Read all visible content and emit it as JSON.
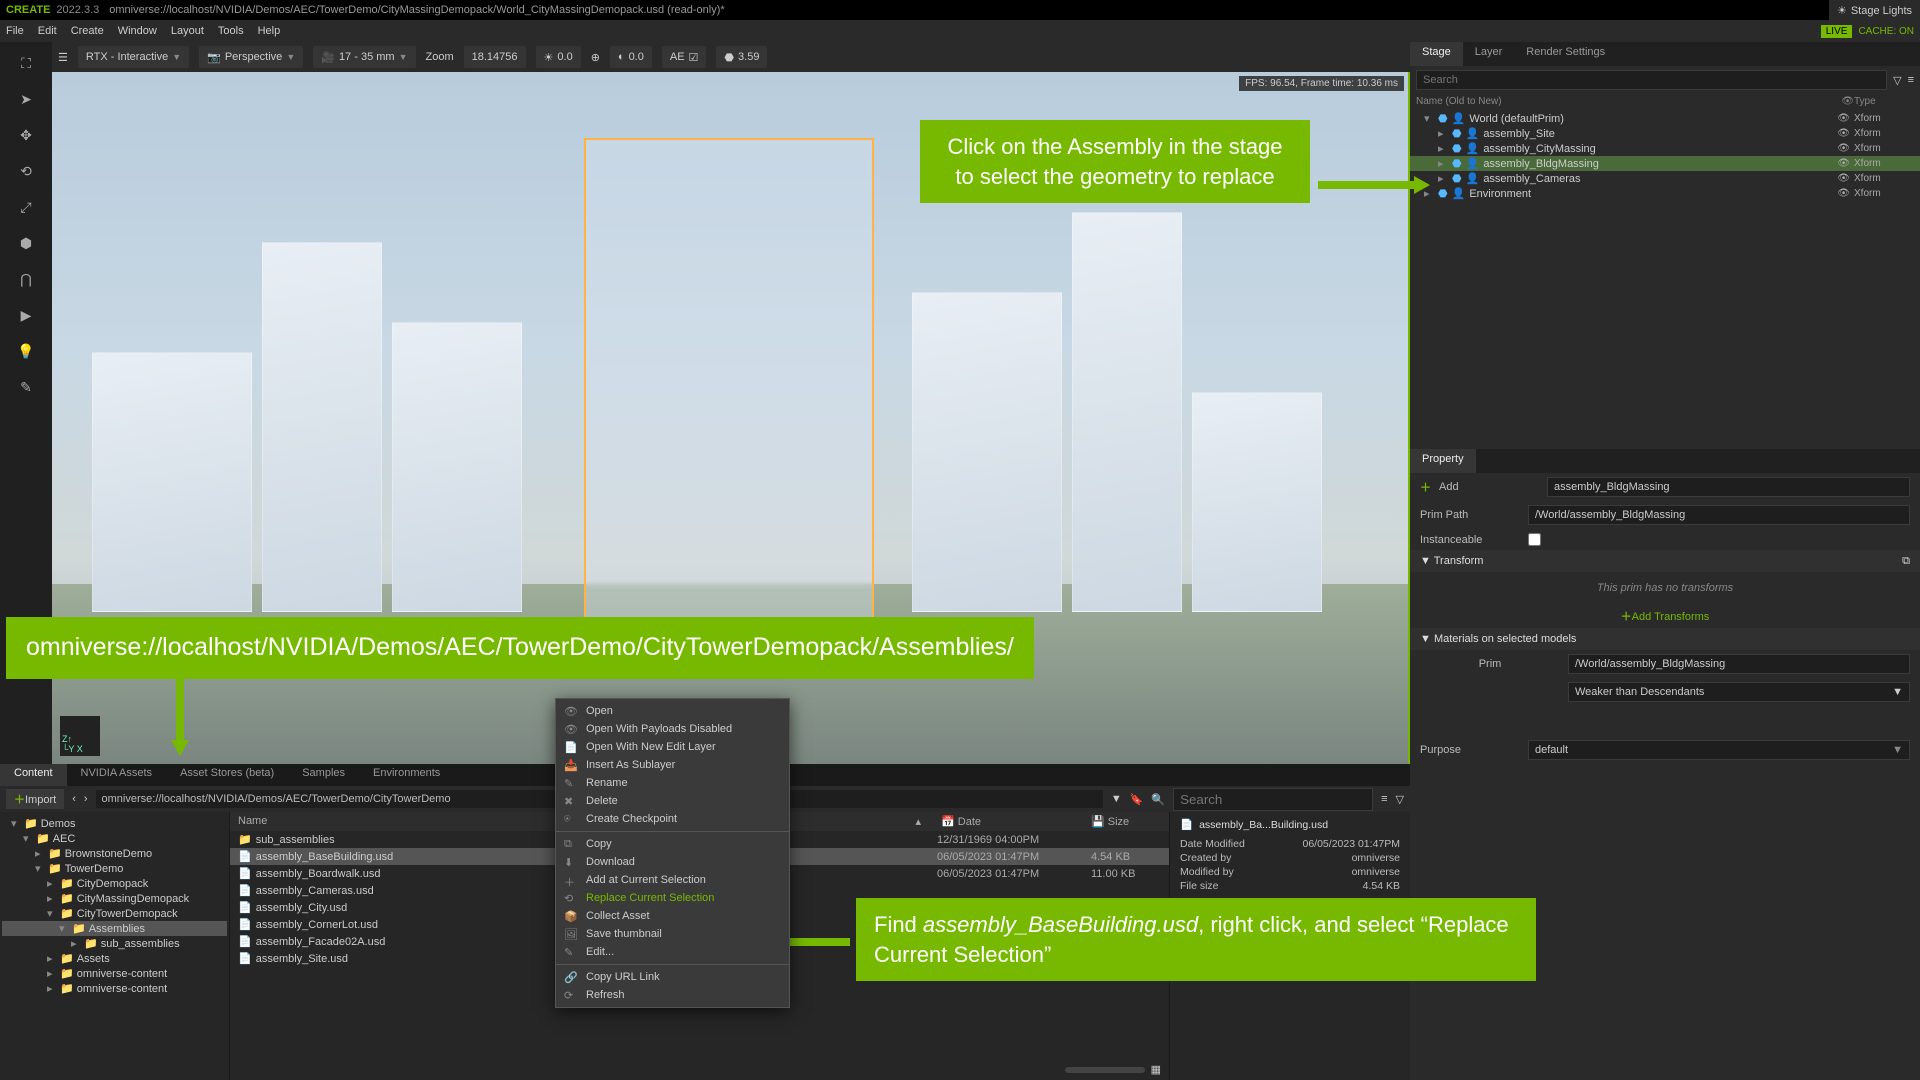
{
  "title": {
    "app": "CREATE",
    "ver": "2022.3.3",
    "path": "omniverse://localhost/NVIDIA/Demos/AEC/TowerDemo/CityMassingDemopack/World_CityMassingDemopack.usd (read-only)*"
  },
  "menubar": [
    "File",
    "Edit",
    "Create",
    "Window",
    "Layout",
    "Tools",
    "Help"
  ],
  "live": "LIVE",
  "cache": "CACHE: ON",
  "toolbar": {
    "rtx": "RTX - Interactive",
    "persp": "Perspective",
    "lens": "17 - 35 mm",
    "zoom_lbl": "Zoom",
    "zoom": "18.14756",
    "exp1": "0.0",
    "exp2": "0.0",
    "ae": "AE",
    "fstop": "3.59",
    "stagelights": "Stage Lights"
  },
  "vp": {
    "fps": "FPS: 96.54, Frame time: 10.36 ms"
  },
  "rightTabs": [
    "Stage",
    "Layer",
    "Render Settings"
  ],
  "search_ph": "Search",
  "stageHdr": {
    "name": "Name (Old to New)",
    "type": "Type"
  },
  "stageTree": [
    {
      "depth": 0,
      "exp": "▾",
      "name": "World (defaultPrim)",
      "type": "Xform",
      "sel": false
    },
    {
      "depth": 1,
      "exp": "▸",
      "name": "assembly_Site",
      "type": "Xform",
      "sel": false
    },
    {
      "depth": 1,
      "exp": "▸",
      "name": "assembly_CityMassing",
      "type": "Xform",
      "sel": false
    },
    {
      "depth": 1,
      "exp": "▸",
      "name": "assembly_BldgMassing",
      "type": "Xform",
      "sel": true
    },
    {
      "depth": 1,
      "exp": "▸",
      "name": "assembly_Cameras",
      "type": "Xform",
      "sel": false
    },
    {
      "depth": 0,
      "exp": "▸",
      "name": "Environment",
      "type": "Xform",
      "sel": false
    }
  ],
  "propTab": "Property",
  "prop": {
    "add": "Add",
    "add_val": "assembly_BldgMassing",
    "primpath_lbl": "Prim Path",
    "primpath": "/World/assembly_BldgMassing",
    "inst": "Instanceable",
    "transform": "Transform",
    "notrans": "This prim has no transforms",
    "addtrans": "Add Transforms",
    "matsel": "Materials on selected models",
    "prim_lbl": "Prim",
    "prim_val": "/World/assembly_BldgMassing",
    "strength": "Weaker than Descendants",
    "purpose_lbl": "Purpose",
    "purpose_val": "default"
  },
  "contentTabs": [
    "Content",
    "NVIDIA Assets",
    "Asset Stores (beta)",
    "Samples",
    "Environments"
  ],
  "import": "Import",
  "breadcrumb": "omniverse://localhost/NVIDIA/Demos/AEC/TowerDemo/CityTowerDemo",
  "folderTree": [
    {
      "d": 0,
      "n": "Demos",
      "exp": "▾"
    },
    {
      "d": 1,
      "n": "AEC",
      "exp": "▾"
    },
    {
      "d": 2,
      "n": "BrownstoneDemo",
      "exp": "▸"
    },
    {
      "d": 2,
      "n": "TowerDemo",
      "exp": "▾"
    },
    {
      "d": 3,
      "n": "CityDemopack",
      "exp": "▸"
    },
    {
      "d": 3,
      "n": "CityMassingDemopack",
      "exp": "▸"
    },
    {
      "d": 3,
      "n": "CityTowerDemopack",
      "exp": "▾"
    },
    {
      "d": 4,
      "n": "Assemblies",
      "exp": "▾",
      "sel": true
    },
    {
      "d": 5,
      "n": "sub_assemblies",
      "exp": "▸"
    },
    {
      "d": 3,
      "n": "Assets",
      "exp": "▸"
    },
    {
      "d": 3,
      "n": "omniverse-content",
      "exp": "▸"
    },
    {
      "d": 3,
      "n": "omniverse-content",
      "exp": "▸"
    }
  ],
  "fileHdr": {
    "name": "Name",
    "date": "Date",
    "size": "Size"
  },
  "files": [
    {
      "n": "sub_assemblies",
      "d": "12/31/1969 04:00PM",
      "s": "",
      "folder": true
    },
    {
      "n": "assembly_BaseBuilding.usd",
      "d": "06/05/2023 01:47PM",
      "s": "4.54 KB",
      "sel": true
    },
    {
      "n": "assembly_Boardwalk.usd",
      "d": "06/05/2023 01:47PM",
      "s": "11.00 KB"
    },
    {
      "n": "assembly_Cameras.usd",
      "d": "",
      "s": ""
    },
    {
      "n": "assembly_City.usd",
      "d": "",
      "s": ""
    },
    {
      "n": "assembly_CornerLot.usd",
      "d": "",
      "s": ""
    },
    {
      "n": "assembly_Facade02A.usd",
      "d": "",
      "s": ""
    },
    {
      "n": "assembly_Site.usd",
      "d": "",
      "s": ""
    }
  ],
  "detail": {
    "title": "assembly_Ba...Building.usd",
    "rows": [
      [
        "Date Modified",
        "06/05/2023 01:47PM"
      ],
      [
        "Created by",
        "omniverse"
      ],
      [
        "Modified by",
        "omniverse"
      ],
      [
        "File size",
        "4.54 KB"
      ]
    ]
  },
  "ctx": [
    {
      "t": "Open",
      "i": "👁"
    },
    {
      "t": "Open With Payloads Disabled",
      "i": "👁"
    },
    {
      "t": "Open With New Edit Layer",
      "i": "📄"
    },
    {
      "t": "Insert As Sublayer",
      "i": "📥"
    },
    {
      "t": "Rename",
      "i": "✎"
    },
    {
      "t": "Delete",
      "i": "✖"
    },
    {
      "t": "Create Checkpoint",
      "i": "⍟"
    },
    {
      "sep": true
    },
    {
      "t": "Copy",
      "i": "⧉"
    },
    {
      "t": "Download",
      "i": "⬇"
    },
    {
      "t": "Add at Current Selection",
      "i": "＋"
    },
    {
      "t": "Replace Current Selection",
      "i": "⟲",
      "hl": true
    },
    {
      "t": "Collect Asset",
      "i": "📦"
    },
    {
      "t": "Save thumbnail",
      "i": "🖼"
    },
    {
      "t": "Edit...",
      "i": "✎"
    },
    {
      "sep": true
    },
    {
      "t": "Copy URL Link",
      "i": "🔗"
    },
    {
      "t": "Refresh",
      "i": "⟳"
    }
  ],
  "callouts": {
    "c1": "Click on the Assembly in the stage to select the geometry to replace",
    "c2": "omniverse://localhost/NVIDIA/Demos/AEC/TowerDemo/CityTowerDemopack/Assemblies/",
    "c3a": "Find ",
    "c3b": "assembly_BaseBuilding.usd",
    "c3c": ", right click, and select “Replace Current Selection”"
  }
}
